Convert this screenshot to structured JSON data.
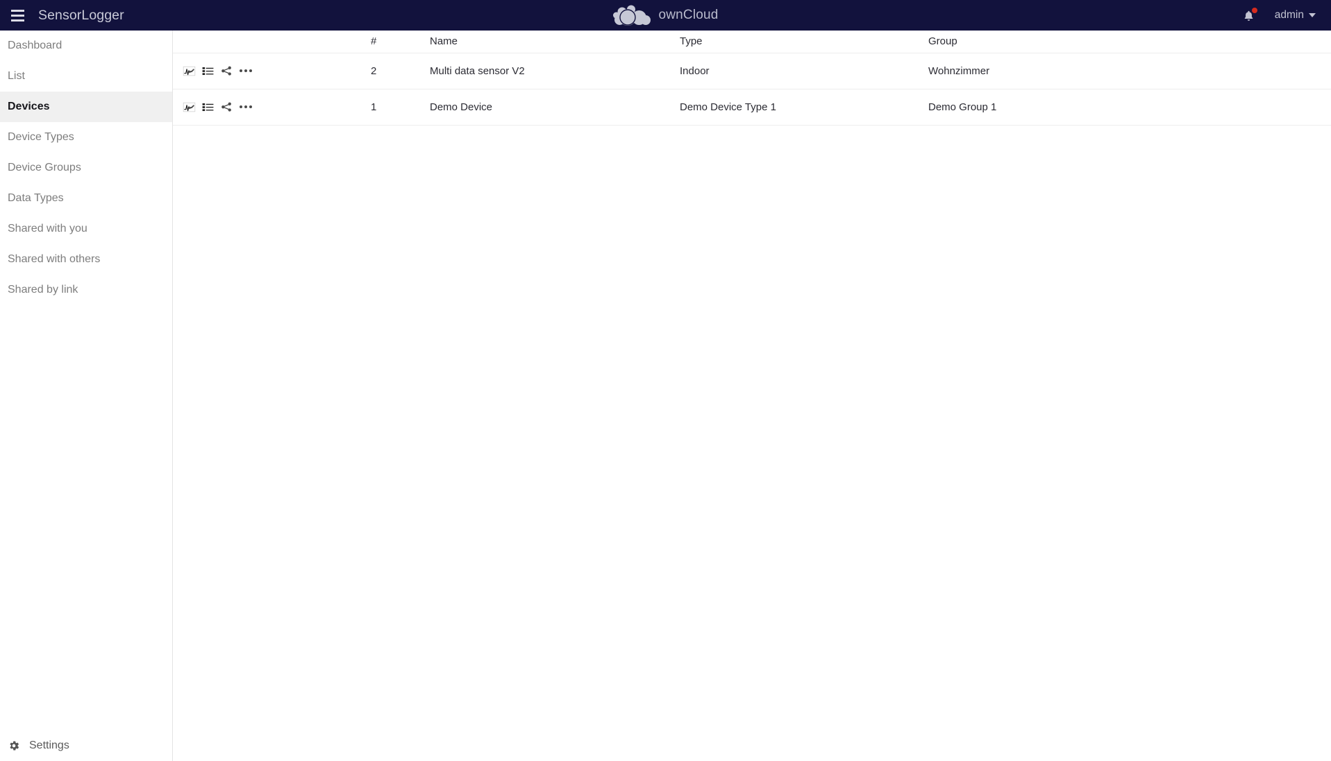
{
  "topbar": {
    "menu_icon": "hamburger-icon",
    "brand": "SensorLogger",
    "logo_name": "ownCloud",
    "logo_icon": "owncloud-cloud-logo",
    "notification_icon": "bell-icon",
    "notification_badge": "",
    "user": "admin",
    "caret_icon": "chevron-down-icon",
    "colors": {
      "bar_background": "#12123d",
      "brand_text": "#c9cad8",
      "badge": "#d52b1e"
    }
  },
  "sidebar": {
    "items": [
      {
        "label": "Dashboard",
        "active": false
      },
      {
        "label": "List",
        "active": false
      },
      {
        "label": "Devices",
        "active": true
      },
      {
        "label": "Device Types",
        "active": false
      },
      {
        "label": "Device Groups",
        "active": false
      },
      {
        "label": "Data Types",
        "active": false
      },
      {
        "label": "Shared with you",
        "active": false
      },
      {
        "label": "Shared with others",
        "active": false
      },
      {
        "label": "Shared by link",
        "active": false
      }
    ],
    "settings": {
      "label": "Settings",
      "icon": "gear-icon"
    },
    "active_background": "#f0f0f0"
  },
  "table": {
    "columns": [
      "",
      "#",
      "Name",
      "Type",
      "Group"
    ],
    "row_action_icons": [
      "chart-icon",
      "list-icon",
      "share-icon",
      "more-options-icon"
    ],
    "rows": [
      {
        "number": "2",
        "name": "Multi data sensor V2",
        "type": "Indoor",
        "group": "Wohnzimmer"
      },
      {
        "number": "1",
        "name": "Demo Device",
        "type": "Demo Device Type 1",
        "group": "Demo Group 1"
      }
    ]
  }
}
